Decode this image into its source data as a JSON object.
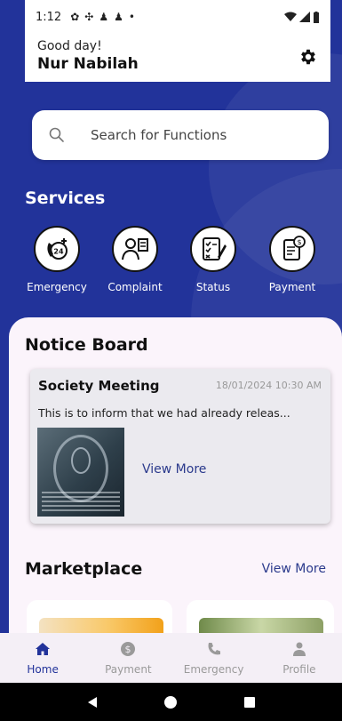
{
  "status_bar": {
    "time": "1:12"
  },
  "header": {
    "greeting": "Good day!",
    "user_name": "Nur Nabilah"
  },
  "search": {
    "placeholder": "Search for Functions"
  },
  "services": {
    "title": "Services",
    "items": [
      {
        "label": "Emergency",
        "icon": "emergency-24-icon"
      },
      {
        "label": "Complaint",
        "icon": "complaint-icon"
      },
      {
        "label": "Status",
        "icon": "status-checklist-icon"
      },
      {
        "label": "Payment",
        "icon": "payment-invoice-icon"
      }
    ]
  },
  "notice_board": {
    "title": "Notice Board",
    "card": {
      "title": "Society Meeting",
      "date": "18/01/2024 10:30 AM",
      "text": "This is to inform that we had already releas...",
      "view_more": "View More"
    }
  },
  "marketplace": {
    "title": "Marketplace",
    "view_more": "View More"
  },
  "bottom_nav": {
    "items": [
      {
        "label": "Home",
        "icon": "home-icon",
        "active": true
      },
      {
        "label": "Payment",
        "icon": "dollar-icon",
        "active": false
      },
      {
        "label": "Emergency",
        "icon": "phone-icon",
        "active": false
      },
      {
        "label": "Profile",
        "icon": "person-icon",
        "active": false
      }
    ]
  },
  "colors": {
    "primary": "#22339A",
    "panel": "#FBF4FB",
    "link": "#2B3A8C"
  }
}
